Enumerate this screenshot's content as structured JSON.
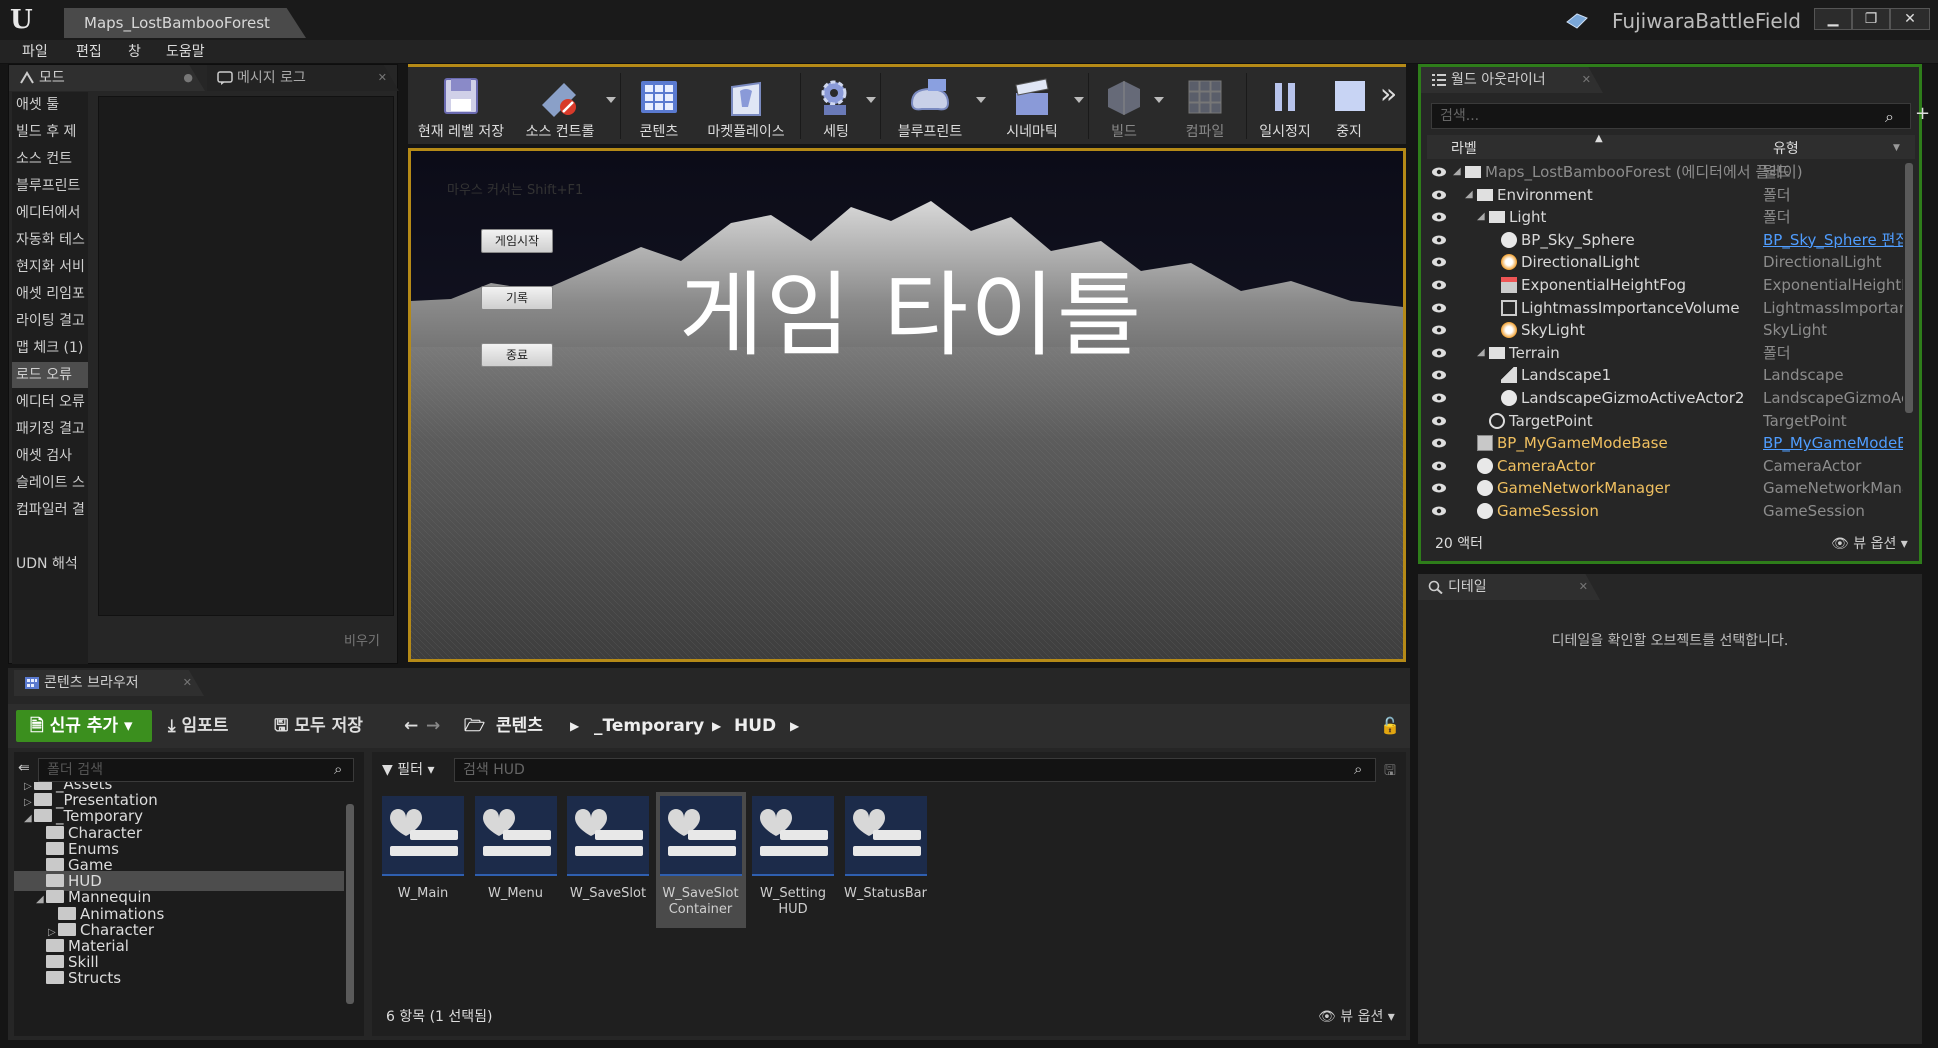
{
  "window": {
    "title_tab": "Maps_LostBambooForest",
    "project_name": "FujiwaraBattleField",
    "logo": "U"
  },
  "menu": [
    "파일",
    "편집",
    "창",
    "도움말"
  ],
  "left_panel": {
    "tabs": [
      "모드",
      "메시지 로그"
    ],
    "items": [
      "애셋 툴",
      "빌드 후 제",
      "소스 컨트",
      "블루프린트",
      "에디터에서",
      "자동화 테스",
      "현지화 서비",
      "애셋 리임포",
      "라이팅 결고",
      "맵 체크 (1)",
      "로드 오류",
      "에디터 오류",
      "패키징 결고",
      "애셋 검사",
      "슬레이트 스",
      "컴파일러 결",
      "UDN 해석"
    ],
    "selected": "로드 오류",
    "clear_label": "비우기"
  },
  "toolbar": {
    "buttons": [
      "현재 레벨 저장",
      "소스 컨트롤",
      "콘텐츠",
      "마켓플레이스",
      "세팅",
      "블루프린트",
      "시네마틱",
      "빌드",
      "컴파일",
      "일시정지",
      "중지"
    ],
    "more": "»"
  },
  "viewport": {
    "hint": "마우스 커서는 Shift+F1",
    "buttons": [
      "게임시작",
      "기록",
      "종료"
    ],
    "title": "게임 타이틀"
  },
  "outliner": {
    "tab": "월드 아웃라이너",
    "search_placeholder": "검색...",
    "col_label": "라벨",
    "col_type": "유형",
    "rows": [
      {
        "name": "Maps_LostBambooForest (에디터에서 플레이)",
        "type": "월드",
        "dim": true
      },
      {
        "name": "Environment",
        "type": "폴더"
      },
      {
        "name": "Light",
        "type": "폴더"
      },
      {
        "name": "BP_Sky_Sphere",
        "type": "BP_Sky_Sphere 편집",
        "link": true
      },
      {
        "name": "DirectionalLight",
        "type": "DirectionalLight"
      },
      {
        "name": "ExponentialHeightFog",
        "type": "ExponentialHeightFog"
      },
      {
        "name": "LightmassImportanceVolume",
        "type": "LightmassImportanceVolume"
      },
      {
        "name": "SkyLight",
        "type": "SkyLight"
      },
      {
        "name": "Terrain",
        "type": "폴더"
      },
      {
        "name": "Landscape1",
        "type": "Landscape"
      },
      {
        "name": "LandscapeGizmoActiveActor2",
        "type": "LandscapeGizmoActiveActor"
      },
      {
        "name": "TargetPoint",
        "type": "TargetPoint"
      },
      {
        "name": "BP_MyGameModeBase",
        "type": "BP_MyGameModeBase 편집",
        "link": true,
        "accent": true
      },
      {
        "name": "CameraActor",
        "type": "CameraActor",
        "accent": true
      },
      {
        "name": "GameNetworkManager",
        "type": "GameNetworkManager",
        "accent": true
      },
      {
        "name": "GameSession",
        "type": "GameSession",
        "accent": true
      }
    ],
    "count": "20 액터",
    "view_options": "뷰 옵션"
  },
  "details": {
    "tab": "디테일",
    "message": "디테일을 확인할 오브젝트를 선택합니다."
  },
  "content_browser": {
    "tab": "콘텐츠 브라우저",
    "add_new": "신규 추가",
    "import": "임포트",
    "save_all": "모두 저장",
    "breadcrumb": [
      "콘텐츠",
      "_Temporary",
      "HUD"
    ],
    "folder_search_placeholder": "폴더 검색",
    "tree": [
      {
        "label": "_Assets",
        "indent": 0,
        "tri": "▷"
      },
      {
        "label": "_Presentation",
        "indent": 0,
        "tri": "▷"
      },
      {
        "label": "_Temporary",
        "indent": 0,
        "tri": "◢"
      },
      {
        "label": "Character",
        "indent": 1,
        "tri": ""
      },
      {
        "label": "Enums",
        "indent": 1,
        "tri": ""
      },
      {
        "label": "Game",
        "indent": 1,
        "tri": ""
      },
      {
        "label": "HUD",
        "indent": 1,
        "tri": "",
        "selected": true
      },
      {
        "label": "Mannequin",
        "indent": 1,
        "tri": "◢"
      },
      {
        "label": "Animations",
        "indent": 2,
        "tri": ""
      },
      {
        "label": "Character",
        "indent": 2,
        "tri": "▷"
      },
      {
        "label": "Material",
        "indent": 1,
        "tri": ""
      },
      {
        "label": "Skill",
        "indent": 1,
        "tri": ""
      },
      {
        "label": "Structs",
        "indent": 1,
        "tri": ""
      }
    ],
    "filter_label": "필터",
    "search_placeholder": "검색 HUD",
    "assets": [
      "W_Main",
      "W_Menu",
      "W_SaveSlot",
      "W_SaveSlot Container",
      "W_Setting HUD",
      "W_StatusBar"
    ],
    "selected_asset": "W_SaveSlot Container",
    "count": "6 항목 (1 선택됨)",
    "view_options": "뷰 옵션"
  },
  "colors": {
    "accent_orange": "#b58a17",
    "outliner_border": "#2e7d1a",
    "add_new_green": "#3b8f1e",
    "link_blue": "#4f9dff",
    "gameplay_actor": "#f0c060"
  }
}
